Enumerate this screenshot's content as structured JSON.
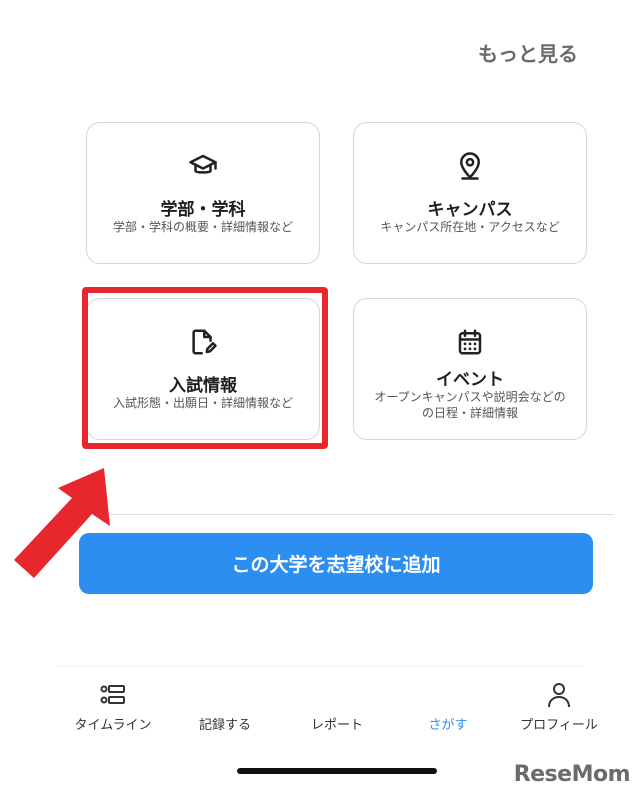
{
  "header": {
    "more_label": "もっと見る"
  },
  "cards": [
    {
      "title": "学部・学科",
      "desc": "学部・学科の概要・詳細情報など",
      "icon": "graduation-cap-icon"
    },
    {
      "title": "キャンパス",
      "desc": "キャンパス所在地・アクセスなど",
      "icon": "location-pin-icon"
    },
    {
      "title": "入試情報",
      "desc": "入試形態・出願日・詳細情報など",
      "icon": "document-edit-icon"
    },
    {
      "title": "イベント",
      "desc_line1": "オープンキャンパスや説明会などの",
      "desc_line2": "の日程・詳細情報",
      "icon": "calendar-icon"
    }
  ],
  "main_button": {
    "label": "この大学を志望校に追加"
  },
  "tabs": [
    {
      "label": "タイムライン",
      "icon": "timeline-icon"
    },
    {
      "label": "記録する"
    },
    {
      "label": "レポート"
    },
    {
      "label": "さがす",
      "active": true
    },
    {
      "label": "プロフィール",
      "icon": "person-icon"
    }
  ],
  "watermark": "ReseMom",
  "colors": {
    "accent": "#2b8ef0",
    "highlight": "#e8262d"
  }
}
